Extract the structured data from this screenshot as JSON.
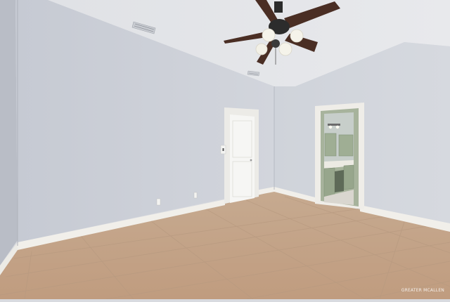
{
  "scene": {
    "description_type": "photograph",
    "watermark": "GREATER MCALLEN"
  },
  "colors": {
    "wall_left": "#d0d4dc",
    "wall_back": "#c9cdd5",
    "wall_right": "#d3d7de",
    "ceiling": "#e4e6ea",
    "floor_tile": "#c9a98c",
    "baseboard": "#f3f1ec",
    "door": "#f4f4f4",
    "fan_blade": "#4a2e24",
    "cabinet_green": "#9fae94"
  }
}
